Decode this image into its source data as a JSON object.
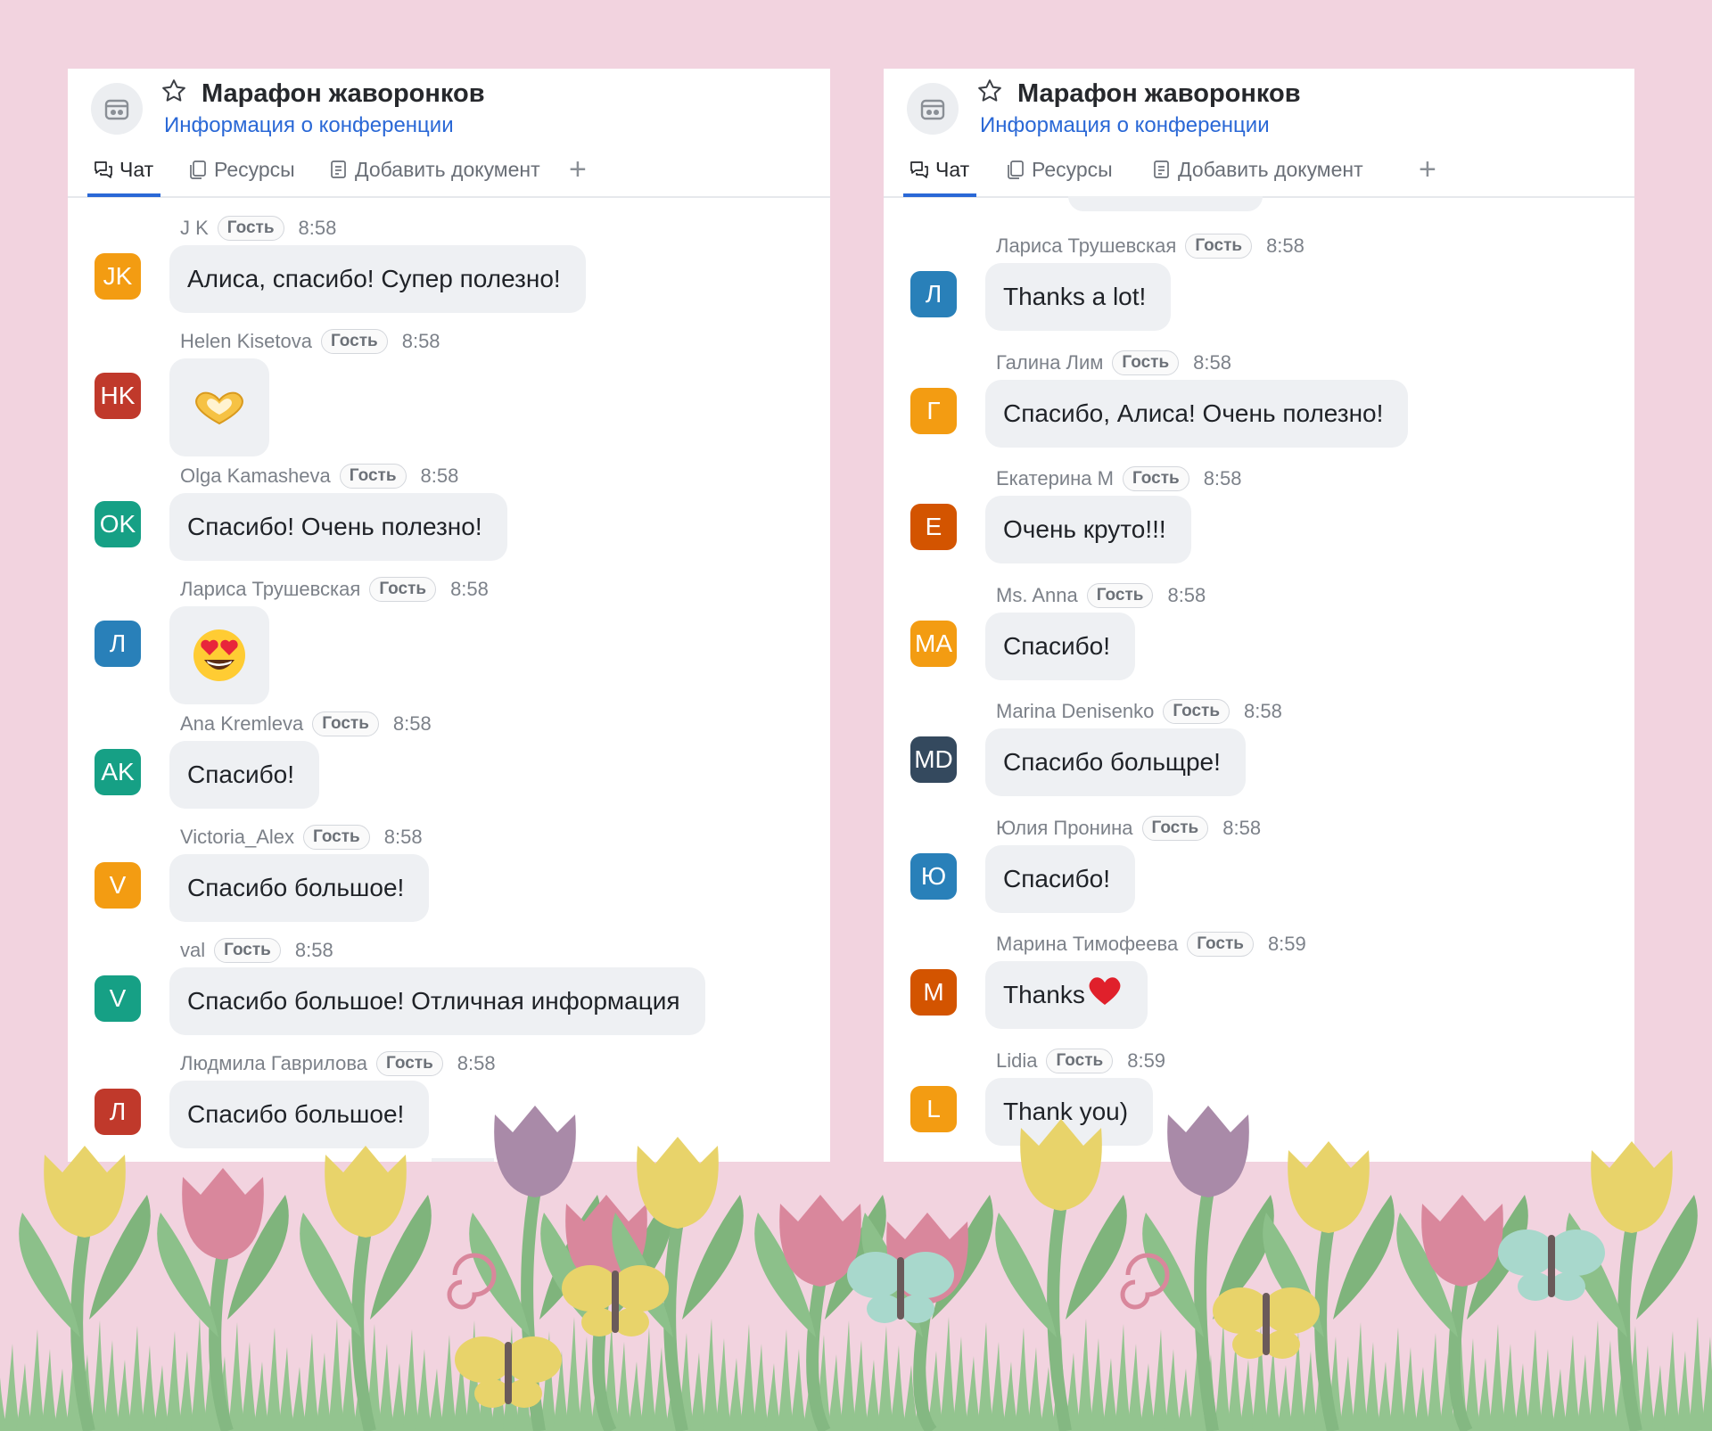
{
  "left_panel": {
    "title": "Марафон жаворонков",
    "subtitle": "Информация о конференции",
    "tabs": {
      "chat": "Чат",
      "resources": "Ресурсы",
      "add_document": "Добавить документ"
    },
    "messages": [
      {
        "author": "J K",
        "badge": "Гость",
        "time": "8:58",
        "avatar": "JK",
        "color": "#f39c12",
        "text": "Алиса, спасибо! Супер полезно!"
      },
      {
        "author": "Helen Kisetova",
        "badge": "Гость",
        "time": "8:58",
        "avatar": "HK",
        "color": "#c0392b",
        "emoji": "heart-hands"
      },
      {
        "author": "Olga Kamasheva",
        "badge": "Гость",
        "time": "8:58",
        "avatar": "OK",
        "color": "#16a085",
        "text": "Спасибо! Очень полезно!"
      },
      {
        "author": "Лариса Трушевская",
        "badge": "Гость",
        "time": "8:58",
        "avatar": "Л",
        "color": "#2980b9",
        "emoji": "heart-eyes"
      },
      {
        "author": "Ana Kremleva",
        "badge": "Гость",
        "time": "8:58",
        "avatar": "AK",
        "color": "#16a085",
        "text": "Спасибо!"
      },
      {
        "author": "Victoria_Alex",
        "badge": "Гость",
        "time": "8:58",
        "avatar": "V",
        "color": "#f39c12",
        "text": "Спасибо большое!"
      },
      {
        "author": "val",
        "badge": "Гость",
        "time": "8:58",
        "avatar": "V",
        "color": "#16a085",
        "text": "Спасибо большое! Отличная информация"
      },
      {
        "author": "Людмила Гаврилова",
        "badge": "Гость",
        "time": "8:58",
        "avatar": "Л",
        "color": "#c0392b",
        "text": "Спасибо большое!"
      }
    ]
  },
  "right_panel": {
    "title": "Марафон жаворонков",
    "subtitle": "Информация о конференции",
    "tabs": {
      "chat": "Чат",
      "resources": "Ресурсы",
      "add_document": "Добавить документ"
    },
    "messages": [
      {
        "author": "Лариса Трушевская",
        "badge": "Гость",
        "time": "8:58",
        "avatar": "Л",
        "color": "#2980b9",
        "text": "Thanks a lot!"
      },
      {
        "author": "Галина Лим",
        "badge": "Гость",
        "time": "8:58",
        "avatar": "Г",
        "color": "#f39c12",
        "text": "Спасибо, Алиса! Очень полезно!"
      },
      {
        "author": "Екатерина М",
        "badge": "Гость",
        "time": "8:58",
        "avatar": "Е",
        "color": "#d35400",
        "text": "Очень круто!!!"
      },
      {
        "author": "Ms. Anna",
        "badge": "Гость",
        "time": "8:58",
        "avatar": "MA",
        "color": "#f39c12",
        "text": "Спасибо!"
      },
      {
        "author": "Marina Denisenko",
        "badge": "Гость",
        "time": "8:58",
        "avatar": "MD",
        "color": "#34495e",
        "text": "Спасибо больщре!"
      },
      {
        "author": "Юлия Пронина",
        "badge": "Гость",
        "time": "8:58",
        "avatar": "Ю",
        "color": "#2980b9",
        "text": "Спасибо!"
      },
      {
        "author": "Марина Тимофеева",
        "badge": "Гость",
        "time": "8:59",
        "avatar": "М",
        "color": "#d35400",
        "text": "Thanks",
        "trailing_emoji": "red-heart"
      },
      {
        "author": "Lidia",
        "badge": "Гость",
        "time": "8:59",
        "avatar": "L",
        "color": "#f39c12",
        "text": "Thank you)"
      }
    ]
  },
  "colors": {
    "background": "#f2d3df",
    "accent": "#2a68d6",
    "bubble": "#eef0f3",
    "tulip_yellow": "#e8d36a",
    "tulip_pink": "#d9879c",
    "tulip_purple": "#a98aa8",
    "stem": "#84b882"
  }
}
